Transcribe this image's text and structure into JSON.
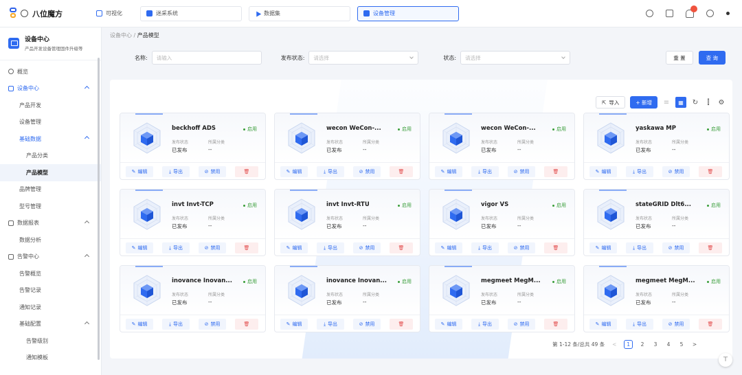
{
  "app": {
    "name": "八位魔方"
  },
  "header": {
    "tabs": [
      {
        "label": "可视化",
        "active": false
      },
      {
        "label": "迷采系统",
        "active": false
      },
      {
        "label": "数据集",
        "active": false
      },
      {
        "label": "设备管理",
        "active": true
      }
    ],
    "right_icons": [
      "speaker-icon",
      "document-icon",
      "bell-icon",
      "gear-icon",
      "user-dot-icon"
    ]
  },
  "sidebar": {
    "section_title": "设备中心",
    "section_subtitle": "产品开发设备管理固件升级等",
    "items": [
      {
        "label": "概览",
        "level": 0,
        "icon": "overview-icon"
      },
      {
        "label": "设备中心",
        "level": 0,
        "icon": "device-center-icon",
        "expanded": true
      },
      {
        "label": "产品开发",
        "level": 1
      },
      {
        "label": "设备管理",
        "level": 1
      },
      {
        "label": "基础数据",
        "level": 1,
        "expanded": true
      },
      {
        "label": "产品分类",
        "level": 2
      },
      {
        "label": "产品模型",
        "level": 2,
        "selected": true
      },
      {
        "label": "品牌管理",
        "level": 1
      },
      {
        "label": "型号管理",
        "level": 1
      },
      {
        "label": "数据报表",
        "level": 0,
        "icon": "report-icon",
        "expanded": true
      },
      {
        "label": "数据分析",
        "level": 1
      },
      {
        "label": "告警中心",
        "level": 0,
        "icon": "alarm-icon",
        "expanded": true
      },
      {
        "label": "告警概览",
        "level": 1
      },
      {
        "label": "告警记录",
        "level": 1
      },
      {
        "label": "通知记录",
        "level": 1
      },
      {
        "label": "基础配置",
        "level": 1,
        "expanded": true
      },
      {
        "label": "告警级别",
        "level": 2
      },
      {
        "label": "通知模板",
        "level": 2
      }
    ]
  },
  "breadcrumb": {
    "parent": "设备中心",
    "separator": "/",
    "current": "产品模型"
  },
  "filters": {
    "name_label": "名称:",
    "name_placeholder": "请输入",
    "publish_label": "发布状态:",
    "publish_placeholder": "请选择",
    "status_label": "状态:",
    "status_placeholder": "请选择",
    "reset_label": "重 置",
    "search_label": "查 询"
  },
  "toolbar": {
    "import_label": "导入",
    "add_label": "+ 新增"
  },
  "card_labels": {
    "publish_key": "发布状态",
    "category_key": "所属分类",
    "edit": "编辑",
    "export": "导出",
    "disable": "禁用"
  },
  "products": [
    {
      "name": "beckhoff ADS",
      "status": "启用",
      "publish": "已发布",
      "category": "--"
    },
    {
      "name": "wecon WeCon-...",
      "status": "启用",
      "publish": "已发布",
      "category": "--"
    },
    {
      "name": "wecon WeCon-...",
      "status": "启用",
      "publish": "已发布",
      "category": "--"
    },
    {
      "name": "yaskawa MP",
      "status": "启用",
      "publish": "已发布",
      "category": "--"
    },
    {
      "name": "invt Invt-TCP",
      "status": "启用",
      "publish": "已发布",
      "category": "--"
    },
    {
      "name": "invt Invt-RTU",
      "status": "启用",
      "publish": "已发布",
      "category": "--"
    },
    {
      "name": "vigor VS",
      "status": "启用",
      "publish": "已发布",
      "category": "--"
    },
    {
      "name": "stateGRID Dlt6...",
      "status": "启用",
      "publish": "已发布",
      "category": "--"
    },
    {
      "name": "inovance Inovan...",
      "status": "启用",
      "publish": "已发布",
      "category": "--"
    },
    {
      "name": "inovance Inovan...",
      "status": "启用",
      "publish": "已发布",
      "category": "--"
    },
    {
      "name": "megmeet MegM...",
      "status": "启用",
      "publish": "已发布",
      "category": "--"
    },
    {
      "name": "megmeet MegM...",
      "status": "启用",
      "publish": "已发布",
      "category": "--"
    }
  ],
  "pagination": {
    "summary": "第 1-12 条/总共 49 条",
    "pages": [
      "1",
      "2",
      "3",
      "4",
      "5"
    ],
    "current": "1",
    "prev": "<",
    "next": ">"
  },
  "colors": {
    "primary": "#2f6bf0",
    "danger": "#e24c4c",
    "success": "#3a9e3a"
  }
}
